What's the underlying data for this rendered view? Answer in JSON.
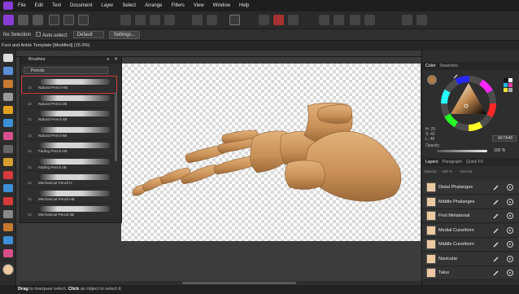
{
  "app": {
    "name": "Affinity Designer"
  },
  "menu": [
    "File",
    "Edit",
    "Text",
    "Document",
    "Layer",
    "Select",
    "Arrange",
    "Filters",
    "View",
    "Window",
    "Help"
  ],
  "context": {
    "selection": "No Selection",
    "auto_select_label": "Auto-select:",
    "auto_select_value": "Default",
    "settings_label": "Settings..."
  },
  "document": {
    "title": "Foot and Ankle Template [Modified] (15.0%)"
  },
  "brushes_panel": {
    "title": "Brushes",
    "category": "Pencils",
    "items": [
      {
        "size": "32",
        "name": "Natural Pencil HB",
        "selected": true
      },
      {
        "size": "32",
        "name": "Natural Pencil 2B",
        "selected": false
      },
      {
        "size": "32",
        "name": "Natural Pencil 4B",
        "selected": false
      },
      {
        "size": "32",
        "name": "Natural Pencil 8B",
        "selected": false
      },
      {
        "size": "32",
        "name": "Fading Pencil HB",
        "selected": false
      },
      {
        "size": "32",
        "name": "Fading Pencil 2B",
        "selected": false
      },
      {
        "size": "32",
        "name": "Mechanical Pencil H",
        "selected": false
      },
      {
        "size": "32",
        "name": "Mechanical Pencil HB",
        "selected": false
      },
      {
        "size": "32",
        "name": "Mechanical Pencil 4B",
        "selected": false
      }
    ]
  },
  "color_panel": {
    "tabs": [
      "Color",
      "Swatches"
    ],
    "h": "H: 29",
    "s": "S: 42",
    "l": "L: 48",
    "hex": "AF7A48",
    "opacity_label": "Opacity",
    "opacity_value": "100 %",
    "colors": {
      "current": "#af7a48",
      "wheel_marker": "#c48a50"
    }
  },
  "layers_panel": {
    "tabs": [
      "Layers",
      "Paragraph",
      "Quick FX"
    ],
    "opacity_label": "Opacity:",
    "opacity_value": "100 %",
    "blend_mode": "Normal",
    "items": [
      {
        "name": "Distal Phalanges"
      },
      {
        "name": "Middle Phalanges"
      },
      {
        "name": "First Metatarsal"
      },
      {
        "name": "Medial Cuneiform"
      },
      {
        "name": "Middle Cuneiform"
      },
      {
        "name": "Navicular"
      },
      {
        "name": "Talus"
      }
    ]
  },
  "status": {
    "key1": "Drag",
    "text1": " to marquee select. ",
    "key2": "Click",
    "text2": " an object to select it."
  },
  "colors": {
    "bone": "#d2a06a",
    "accent_purple": "#8a3cd6",
    "selection_red": "#d63b3b"
  }
}
